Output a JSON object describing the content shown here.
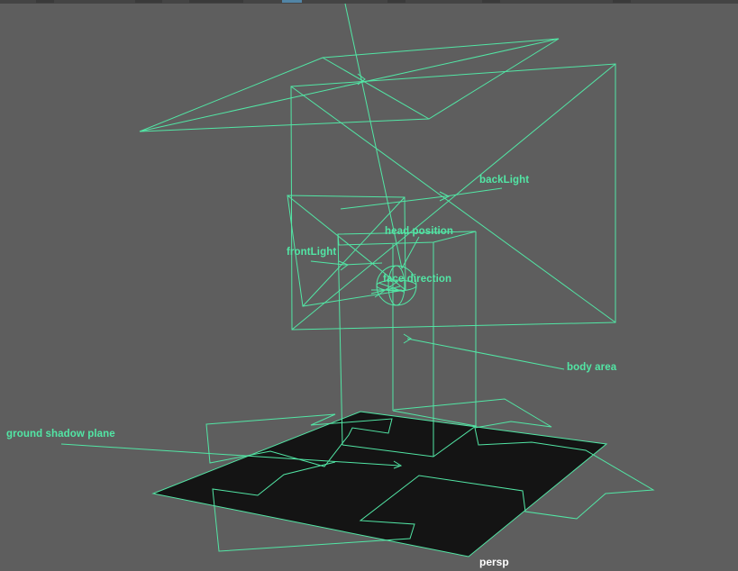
{
  "viewport": {
    "camera_name": "persp",
    "background_color": "#5e5e5e",
    "wire_color": "#52e6a5",
    "camera_label_color": "#ffffff",
    "shadow_plane_color": "#141414"
  },
  "labels": {
    "back_light": "backLight",
    "head_position": "head position",
    "front_light": "frontLight",
    "face_direction": "face direction",
    "body_area": "body area",
    "ground_shadow_plane": "ground shadow plane"
  },
  "icons": {
    "light_locator": "light-locator-icon",
    "head_sphere": "head-sphere-icon",
    "camera": "camera-icon"
  }
}
